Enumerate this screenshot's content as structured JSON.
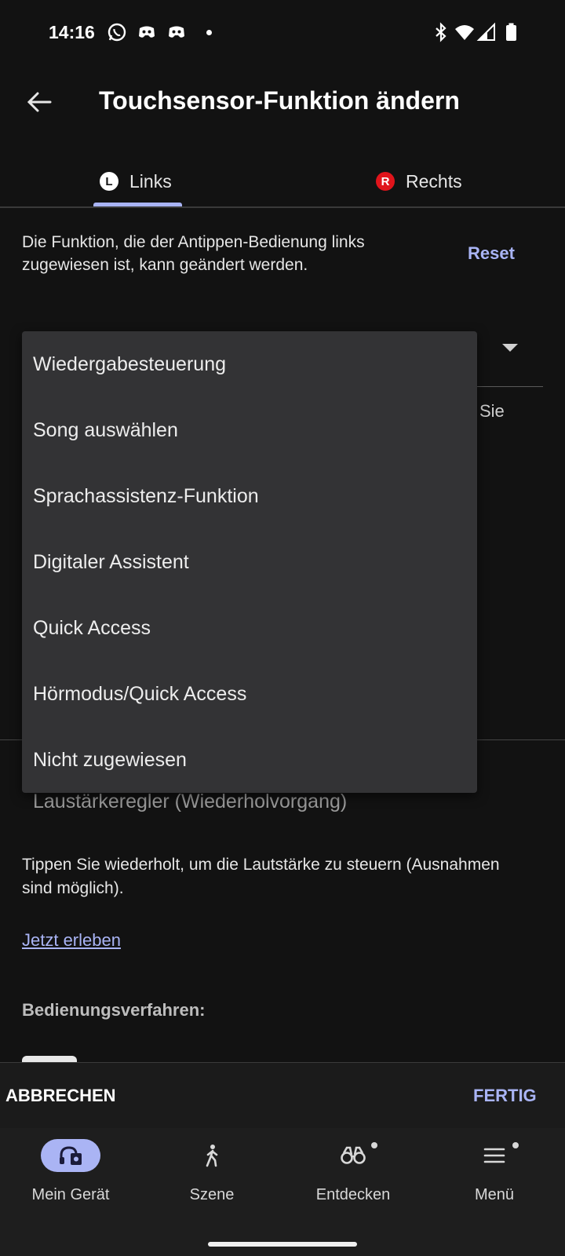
{
  "status_bar": {
    "time": "14:16"
  },
  "app_bar": {
    "title": "Touchsensor-Funktion ändern"
  },
  "tabs": [
    {
      "badge": "L",
      "label": "Links",
      "selected": true
    },
    {
      "badge": "R",
      "label": "Rechts",
      "selected": false
    }
  ],
  "description": "Die Funktion, die der Antippen-Bedienung links zugewiesen ist, kann geändert werden.",
  "reset_label": "Reset",
  "hidden_partial_text": "Sie",
  "dropdown_menu": {
    "options": [
      "Wiedergabesteuerung",
      "Song auswählen",
      "Sprachassistenz-Funktion",
      "Digitaler Assistent",
      "Quick Access",
      "Hörmodus/Quick Access",
      "Nicht zugewiesen"
    ]
  },
  "current_function": "Laustärkeregler (Wiederholvorgang)",
  "tip_text": "Tippen Sie wiederholt, um die Lautstärke zu steuern (Ausnahmen sind möglich).",
  "experience_link": "Jetzt erleben",
  "procedure_heading": "Bedienungsverfahren:",
  "actions": {
    "cancel": "ABBRECHEN",
    "done": "FERTIG"
  },
  "bottom_nav": [
    {
      "label": "Mein Gerät",
      "icon": "headphones-device-icon",
      "active": true
    },
    {
      "label": "Szene",
      "icon": "walking-person-icon",
      "active": false
    },
    {
      "label": "Entdecken",
      "icon": "binoculars-icon",
      "active": false,
      "notification_dot": true
    },
    {
      "label": "Menü",
      "icon": "hamburger-menu-icon",
      "active": false,
      "notification_dot": true
    }
  ],
  "colors": {
    "background": "#121212",
    "accent": "#a9b4f5",
    "menu_bg": "#333335",
    "right_badge": "#e0141b"
  }
}
